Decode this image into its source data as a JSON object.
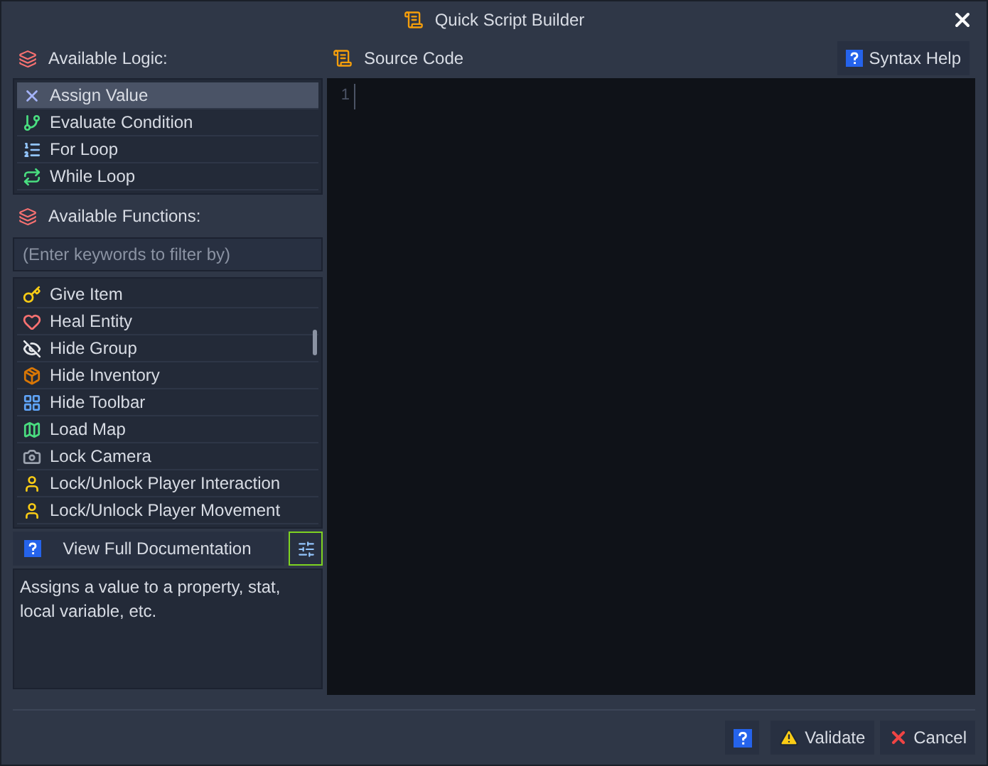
{
  "window": {
    "title": "Quick Script Builder"
  },
  "logic": {
    "heading": "Available Logic:",
    "items": [
      {
        "label": "Assign Value",
        "selected": true
      },
      {
        "label": "Evaluate Condition",
        "selected": false
      },
      {
        "label": "For Loop",
        "selected": false
      },
      {
        "label": "While Loop",
        "selected": false
      }
    ]
  },
  "functions": {
    "heading": "Available Functions:",
    "filter": {
      "placeholder": "(Enter keywords to filter by)"
    },
    "items": [
      {
        "label": "Give Item",
        "selected": false
      },
      {
        "label": "Heal Entity",
        "selected": false
      },
      {
        "label": "Hide Group",
        "selected": false
      },
      {
        "label": "Hide Inventory",
        "selected": false
      },
      {
        "label": "Hide Toolbar",
        "selected": false
      },
      {
        "label": "Load Map",
        "selected": false
      },
      {
        "label": "Lock Camera",
        "selected": false
      },
      {
        "label": "Lock/Unlock Player Interaction",
        "selected": false
      },
      {
        "label": "Lock/Unlock Player Movement",
        "selected": false
      }
    ]
  },
  "documentation_button": "View Full Documentation",
  "description": "Assigns a value to a property, stat, local variable, etc.",
  "source": {
    "heading": "Source Code",
    "syntax_help": "Syntax Help",
    "line_numbers": [
      "1"
    ]
  },
  "footer": {
    "validate": "Validate",
    "cancel": "Cancel"
  }
}
